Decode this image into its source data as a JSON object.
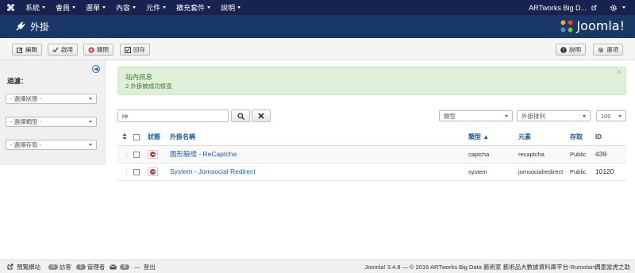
{
  "topnav": {
    "items": [
      "系統",
      "會員",
      "選單",
      "內容",
      "元件",
      "擴充套件",
      "說明"
    ],
    "site": "ARTworks Big D..."
  },
  "header": {
    "title": "外掛",
    "brand": "Joomla!"
  },
  "toolbar": {
    "edit": "編輯",
    "enable": "啟用",
    "disable": "關閉",
    "checkin": "回存",
    "help": "說明",
    "options": "選項"
  },
  "sidebar": {
    "filter_label": "過濾：",
    "status": "- 選擇狀態 -",
    "type": "- 選擇類型 -",
    "access": "- 選擇存取 -"
  },
  "alert": {
    "heading": "站內訊息",
    "message": "2 外掛被成功檢查"
  },
  "search": {
    "value": "re"
  },
  "filters": {
    "type": "類型",
    "order": "外掛排列",
    "limit": "100"
  },
  "table": {
    "headers": {
      "status": "狀態",
      "name": "外掛名稱",
      "type": "類型 ▲",
      "element": "元素",
      "access": "存取",
      "id": "ID"
    },
    "rows": [
      {
        "name": "圖形驗證 - ReCaptcha",
        "type": "captcha",
        "element": "recaptcha",
        "access": "Public",
        "id": "439"
      },
      {
        "name": "System - Jomsocial Redirect",
        "type": "system",
        "element": "jomsocialredirect",
        "access": "Public",
        "id": "10120"
      }
    ]
  },
  "footer": {
    "preview": "預覽網站",
    "visitors_count": "0",
    "visitors": "訪客",
    "admins_count": "1",
    "admins": "管理者",
    "msgs_count": "0",
    "logout": "登出",
    "copyright": "Joomla! 3.4.8 — © 2016 ARTworks Big Data 藝術家 藝術品大數據資料庫平台-Rumotan偶墨當虎之助"
  }
}
